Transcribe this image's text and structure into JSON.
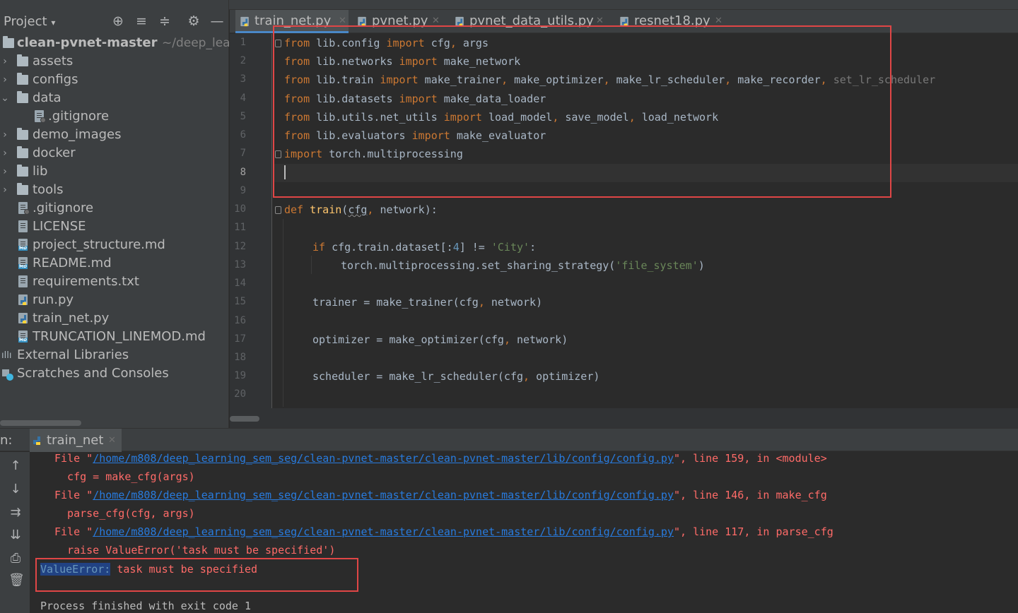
{
  "project": {
    "title": "Project",
    "tree": [
      {
        "label": "clean-pvnet-master",
        "path": "~/deep_lea",
        "type": "root"
      },
      {
        "label": "assets",
        "type": "folder",
        "state": "collapsed"
      },
      {
        "label": "configs",
        "type": "folder",
        "state": "collapsed"
      },
      {
        "label": "data",
        "type": "folder",
        "state": "expanded"
      },
      {
        "label": ".gitignore",
        "type": "file",
        "nested": true
      },
      {
        "label": "demo_images",
        "type": "folder",
        "state": "collapsed"
      },
      {
        "label": "docker",
        "type": "folder",
        "state": "collapsed"
      },
      {
        "label": "lib",
        "type": "folder",
        "state": "collapsed"
      },
      {
        "label": "tools",
        "type": "folder",
        "state": "collapsed"
      },
      {
        "label": ".gitignore",
        "type": "file"
      },
      {
        "label": "LICENSE",
        "type": "file"
      },
      {
        "label": "project_structure.md",
        "type": "md"
      },
      {
        "label": "README.md",
        "type": "md"
      },
      {
        "label": "requirements.txt",
        "type": "file"
      },
      {
        "label": "run.py",
        "type": "py"
      },
      {
        "label": "train_net.py",
        "type": "py"
      },
      {
        "label": "TRUNCATION_LINEMOD.md",
        "type": "md"
      },
      {
        "label": "External Libraries",
        "type": "libs"
      },
      {
        "label": "Scratches and Consoles",
        "type": "scratch"
      }
    ]
  },
  "editor": {
    "tabs": [
      {
        "label": "train_net.py",
        "active": true
      },
      {
        "label": "pvnet.py",
        "active": false
      },
      {
        "label": "pvnet_data_utils.py",
        "active": false
      },
      {
        "label": "resnet18.py",
        "active": false
      }
    ],
    "line_numbers": [
      "1",
      "2",
      "3",
      "4",
      "5",
      "6",
      "7",
      "8",
      "9",
      "10",
      "11",
      "12",
      "13",
      "14",
      "15",
      "16",
      "17",
      "18",
      "19",
      "20"
    ],
    "current_line": "8",
    "code": {
      "l1": [
        "from",
        " lib.config ",
        "import",
        " cfg",
        ", ",
        "args"
      ],
      "l2": [
        "from",
        " lib.networks ",
        "import",
        " make_network"
      ],
      "l3": [
        "from",
        " lib.train ",
        "import",
        " make_trainer",
        ", ",
        "make_optimizer",
        ", ",
        "make_lr_scheduler",
        ", ",
        "make_recorder",
        ", ",
        "set_lr_scheduler"
      ],
      "l4": [
        "from",
        " lib.datasets ",
        "import",
        " make_data_loader"
      ],
      "l5": [
        "from",
        " lib.utils.net_utils ",
        "import",
        " load_model",
        ", ",
        "save_model",
        ", ",
        "load_network"
      ],
      "l6": [
        "from",
        " lib.evaluators ",
        "import",
        " make_evaluator"
      ],
      "l7": [
        "import",
        " torch.multiprocessing"
      ],
      "l10": [
        "def ",
        "train",
        "(",
        "cfg",
        ", ",
        "network",
        "):"
      ],
      "l12": [
        "if ",
        "cfg.train.dataset[:",
        "4",
        "] != ",
        "'City'",
        ":"
      ],
      "l13": [
        "torch.multiprocessing.set_sharing_strategy(",
        "'file_system'",
        ")"
      ],
      "l15": [
        "trainer = make_trainer(cfg",
        ", ",
        "network)"
      ],
      "l17": [
        "optimizer = make_optimizer(cfg",
        ", ",
        "network)"
      ],
      "l19": [
        "scheduler = make_lr_scheduler(cfg",
        ", ",
        "optimizer)"
      ]
    }
  },
  "run": {
    "label": "n:",
    "tab_label": "train_net",
    "console": [
      {
        "pre": "File \"",
        "link": "/home/m808/deep_learning_sem_seg/clean-pvnet-master/clean-pvnet-master/lib/config/config.py",
        "post": "\", line 159, in <module>"
      },
      {
        "text": "  cfg = make_cfg(args)"
      },
      {
        "pre": "File \"",
        "link": "/home/m808/deep_learning_sem_seg/clean-pvnet-master/clean-pvnet-master/lib/config/config.py",
        "post": "\", line 146, in make_cfg"
      },
      {
        "text": "  parse_cfg(cfg, args)"
      },
      {
        "pre": "File \"",
        "link": "/home/m808/deep_learning_sem_seg/clean-pvnet-master/clean-pvnet-master/lib/config/config.py",
        "post": "\", line 117, in parse_cfg"
      },
      {
        "text": "  raise ValueError('task must be specified')"
      }
    ],
    "error_type": "ValueError:",
    "error_msg": " task must be specified",
    "exit_text": "Process finished with exit code 1"
  },
  "colors": {
    "keyword": "#cc7832",
    "function": "#ffc66d",
    "string": "#6a8759",
    "number": "#6897bb",
    "error": "#ff6b68",
    "link": "#287bde",
    "highlight_box": "#e04646",
    "selection": "#214283"
  }
}
